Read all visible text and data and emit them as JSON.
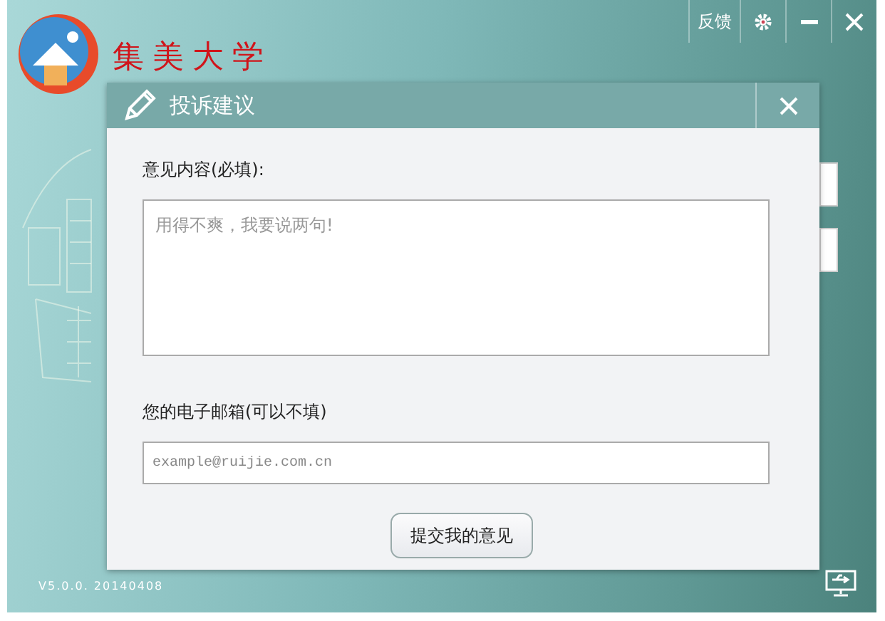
{
  "window": {
    "logo_text": "集美大学",
    "buttons": [
      {
        "kind": "text",
        "label": "反馈"
      },
      {
        "kind": "gear"
      },
      {
        "kind": "minimize"
      },
      {
        "kind": "close"
      }
    ],
    "version": "V5.0.0. 20140408"
  },
  "dialog": {
    "title": "投诉建议",
    "fields": [
      {
        "kind": "textarea",
        "label": "意见内容(必填):",
        "placeholder": "用得不爽，我要说两句!"
      },
      {
        "kind": "input",
        "label": "您的电子邮箱(可以不填)",
        "placeholder": "example@ruijie.com.cn"
      }
    ],
    "submit": "提交我的意见"
  }
}
